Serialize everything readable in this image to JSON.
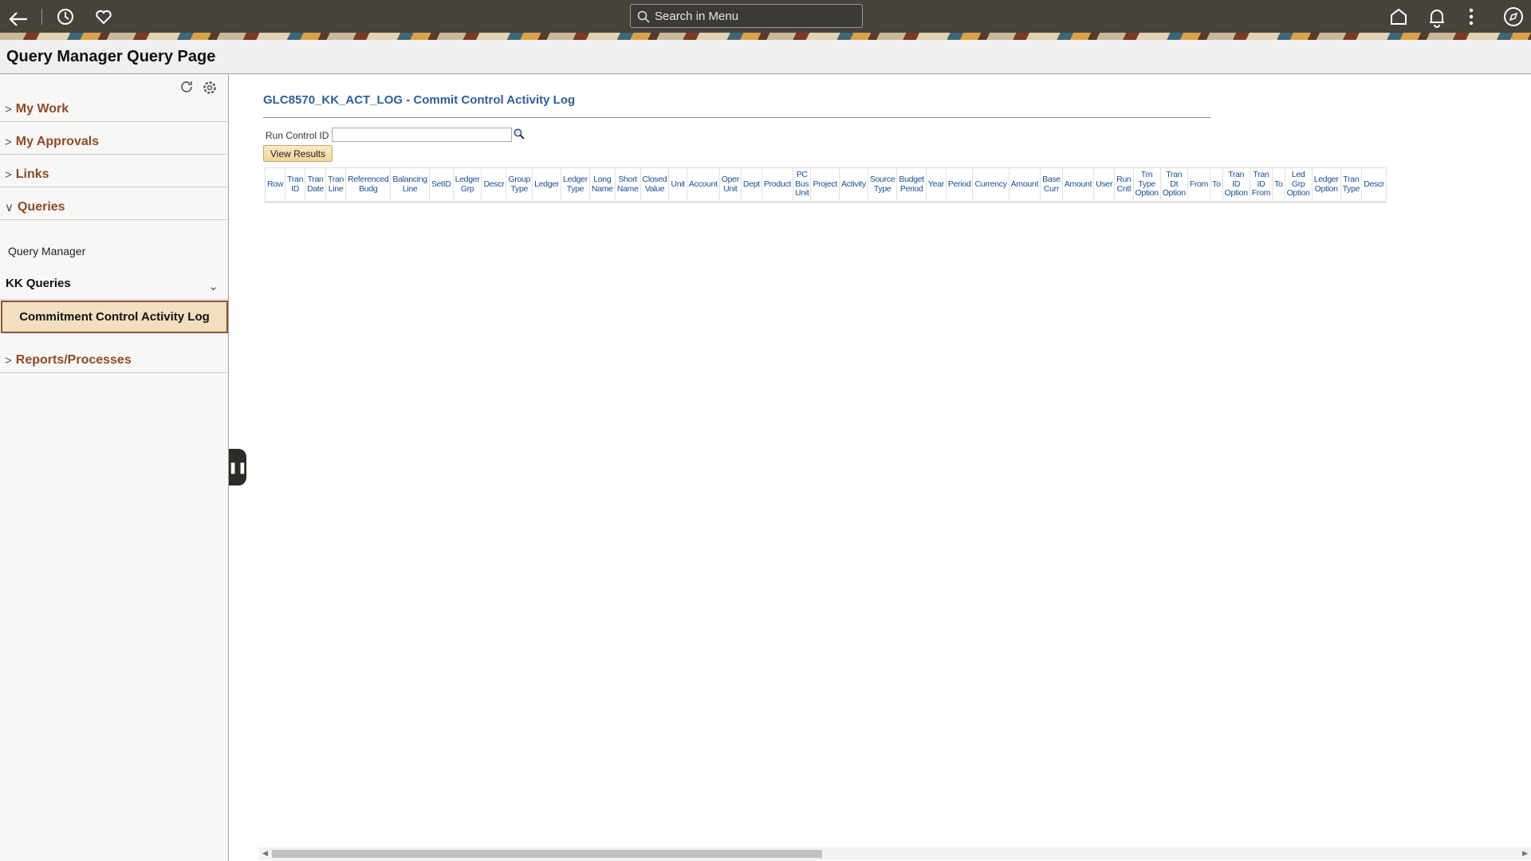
{
  "topbar": {
    "search_placeholder": "Search in Menu",
    "icons": [
      "back-arrow-icon",
      "history-icon",
      "favorites-heart-icon",
      "home-icon",
      "notifications-bell-icon",
      "more-options-icon",
      "navigator-compass-icon"
    ]
  },
  "page_title": "Query Manager Query Page",
  "sidebar": {
    "sections": [
      {
        "label": "My Work"
      },
      {
        "label": "My Approvals"
      },
      {
        "label": "Links"
      },
      {
        "label": "Queries"
      }
    ],
    "query_manager": "Query Manager",
    "group_label": "KK Queries",
    "selected_item": "Commitment Control Activity Log",
    "reports": "Reports/Processes"
  },
  "main": {
    "title": "GLC8570_KK_ACT_LOG - Commit Control Activity Log",
    "run_control_label": "Run Control ID",
    "run_control_value": "",
    "view_results": "View Results",
    "columns": [
      "Row",
      "Tran\nID",
      "Tran\nDate",
      "Tran\nLine",
      "Referenced\nBudg",
      "Balancing\nLine",
      "SetID",
      "Ledger\nGrp",
      "Descr",
      "Group\nType",
      "Ledger",
      "Ledger\nType",
      "Long\nName",
      "Short\nName",
      "Closed\nValue",
      "Unit",
      "Account",
      "Oper\nUnit",
      "Dept",
      "Product",
      "PC\nBus\nUnit",
      "Project",
      "Activity",
      "Source\nType",
      "Budget\nPeriod",
      "Year",
      "Period",
      "Currency",
      "Amount",
      "Base\nCurr",
      "Amount",
      "User",
      "Run\nCntl",
      "Trn\nType\nOption",
      "Tran\nDt\nOption",
      "From",
      "To",
      "Tran\nID\nOption",
      "Tran\nID\nFrom",
      "To",
      "Led\nGrp\nOption",
      "Ledger\nOption",
      "Tran\nType",
      "Descr"
    ]
  },
  "colors": {
    "topbar": "#46433d",
    "accent_link": "#8a4b2a",
    "title_blue": "#2f5e98",
    "selected_bg": "#f2dfbf"
  }
}
